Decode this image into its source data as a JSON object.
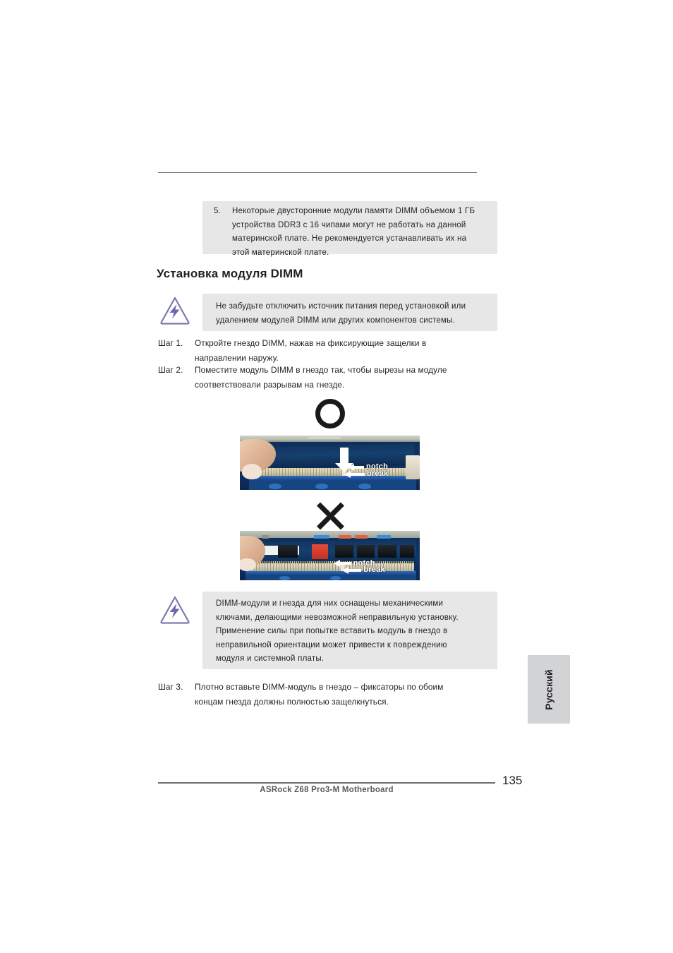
{
  "document": {
    "page_number": "135",
    "footer": "ASRock  Z68 Pro3-M  Motherboard",
    "language_tab": "Русский"
  },
  "note_5": {
    "number": "5.",
    "lines": [
      "Некоторые двусторонние модули памяти DIMM объемом 1 ГБ",
      "устройства DDR3 с 16 чипами могут не работать на данной",
      "материнской плате. Не рекомендуется устанавливать их на",
      "этой материнской плате."
    ]
  },
  "section": {
    "heading": "Установка модуля DIMM"
  },
  "warning_1": {
    "icon": "warning-lightning-icon",
    "lines": [
      "Не забудьте отключить источник питания перед установкой или",
      "удалением модулей DIMM или других компонентов системы."
    ]
  },
  "steps": [
    {
      "label": "Шаг 1.",
      "lines": [
        "Откройте гнездо DIMM, нажав на фиксирующие защелки в",
        "направлении наружу."
      ]
    },
    {
      "label": "Шаг 2.",
      "lines": [
        "Поместите модуль DIMM в гнездо так, чтобы вырезы на модуле",
        "соответствовали разрывам на гнезде."
      ]
    },
    {
      "label": "Шаг 3.",
      "lines": [
        "Плотно вставьте DIMM-модуль в гнездо – фиксаторы по обоим",
        "концам гнезда должны полностью защелкнуться."
      ]
    }
  ],
  "figures": {
    "correct": {
      "mark": "circle-correct-mark",
      "caption_notch": "notch",
      "caption_break": "break"
    },
    "incorrect": {
      "mark": "cross-incorrect-mark",
      "caption_notch": "notch",
      "caption_break": "break"
    }
  },
  "warning_2": {
    "icon": "warning-lightning-icon",
    "lines": [
      "DIMM-модули и гнезда для них оснащены механическими",
      "ключами, делающими невозможной неправильную установку.",
      "Применение силы при попытке вставить модуль в гнездо в",
      "неправильной ориентации может привести к повреждению",
      "модуля и системной платы."
    ]
  },
  "colors": {
    "note_bg": "#e7e7e7",
    "tab_bg": "#d2d3d5",
    "rule": "#6d6e71",
    "text": "#231f20",
    "warn_icon": "#6b6aa8"
  }
}
